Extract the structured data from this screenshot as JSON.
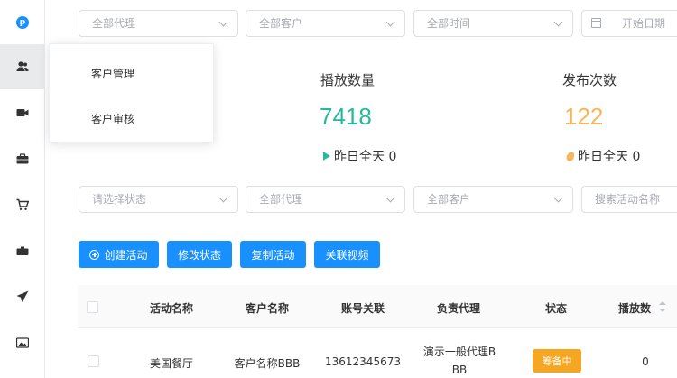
{
  "sidebar": {
    "items": [
      {
        "icon": "logo-icon"
      },
      {
        "icon": "users-icon"
      },
      {
        "icon": "video-icon"
      },
      {
        "icon": "briefcase-icon"
      },
      {
        "icon": "cart-icon"
      },
      {
        "icon": "suitcase-icon"
      },
      {
        "icon": "send-icon"
      },
      {
        "icon": "image-icon"
      }
    ]
  },
  "popup_menu": {
    "items": [
      "客户管理",
      "客户审核"
    ]
  },
  "top_filters": {
    "agent": "全部代理",
    "customer": "全部客户",
    "time": "全部时间",
    "start_date": "开始日期"
  },
  "stats": {
    "plays": {
      "label": "播放数量",
      "value": "7418",
      "sub": "昨日全天 0",
      "color": "#26b8a0"
    },
    "publishes": {
      "label": "发布次数",
      "value": "122",
      "sub": "昨日全天 0",
      "color": "#f7b55c"
    }
  },
  "list_filters": {
    "status": "请选择状态",
    "agent": "全部代理",
    "customer": "全部客户",
    "search_placeholder": "搜索活动名称"
  },
  "actions": {
    "create": "创建活动",
    "modify_status": "修改状态",
    "copy": "复制活动",
    "link_video": "关联视频"
  },
  "table": {
    "columns": [
      "活动名称",
      "客户名称",
      "账号关联",
      "负责代理",
      "状态",
      "播放数"
    ],
    "rows": [
      {
        "name": "美国餐厅",
        "customer": "客户名称BBB",
        "account": "13612345673",
        "agent_line1": "演示一般代理B",
        "agent_line2": "BB",
        "status": "筹备中",
        "plays": "0"
      }
    ]
  },
  "colors": {
    "primary": "#1890ff",
    "teal": "#26b8a0",
    "orange": "#f5a623"
  }
}
